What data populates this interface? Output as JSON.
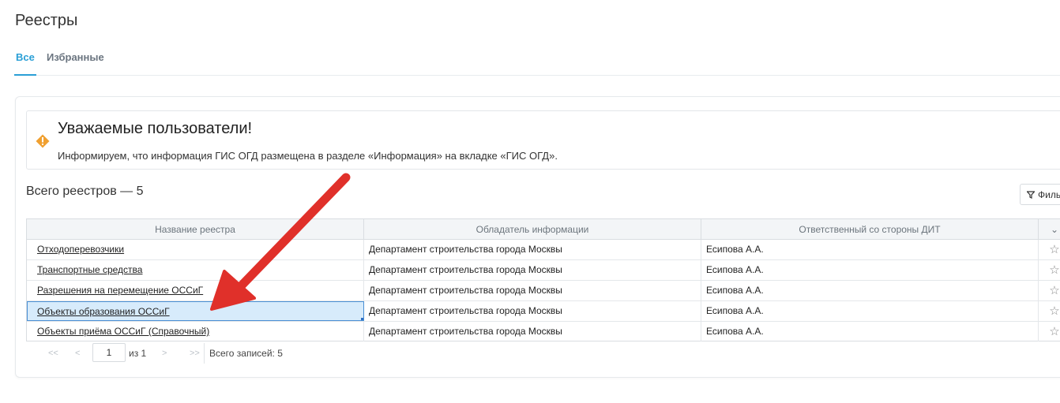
{
  "page": {
    "title": "Реестры"
  },
  "tabs": [
    {
      "label": "Все",
      "active": true
    },
    {
      "label": "Избранные",
      "active": false
    }
  ],
  "notice": {
    "icon": "warning-diamond-icon",
    "title": "Уважаемые пользователи!",
    "text": "Информируем, что информация ГИС ОГД размещена в разделе «Информация» на вкладке «ГИС ОГД»."
  },
  "total_label": "Всего реестров — 5",
  "filter_button": {
    "icon": "filter-icon",
    "label": "Филь"
  },
  "table": {
    "columns": [
      "Название реестра",
      "Обладатель информации",
      "Ответственный со стороны ДИТ"
    ],
    "rows": [
      {
        "name": "Отходоперевозчики",
        "owner": "Департамент строительства города Москвы",
        "responsible": "Есипова А.А.",
        "selected": false
      },
      {
        "name": "Транспортные средства",
        "owner": "Департамент строительства города Москвы",
        "responsible": "Есипова А.А.",
        "selected": false
      },
      {
        "name": "Разрешения на перемещение ОССиГ",
        "owner": "Департамент строительства города Москвы",
        "responsible": "Есипова А.А.",
        "selected": false
      },
      {
        "name": "Объекты образования ОССиГ",
        "owner": "Департамент строительства города Москвы",
        "responsible": "Есипова А.А.",
        "selected": true
      },
      {
        "name": "Объекты приёма ОССиГ (Справочный)",
        "owner": "Департамент строительства города Москвы",
        "responsible": "Есипова А.А.",
        "selected": false
      }
    ]
  },
  "pager": {
    "first": "<<",
    "prev": "<",
    "next": ">",
    "last": ">>",
    "current_page": "1",
    "of_pages": "из 1",
    "total_records": "Всего записей: 5"
  },
  "colors": {
    "accent": "#2a9fd6",
    "warning": "#f0a030",
    "annotation_arrow": "#e0302a",
    "selected_row": "#d7ebfb"
  }
}
